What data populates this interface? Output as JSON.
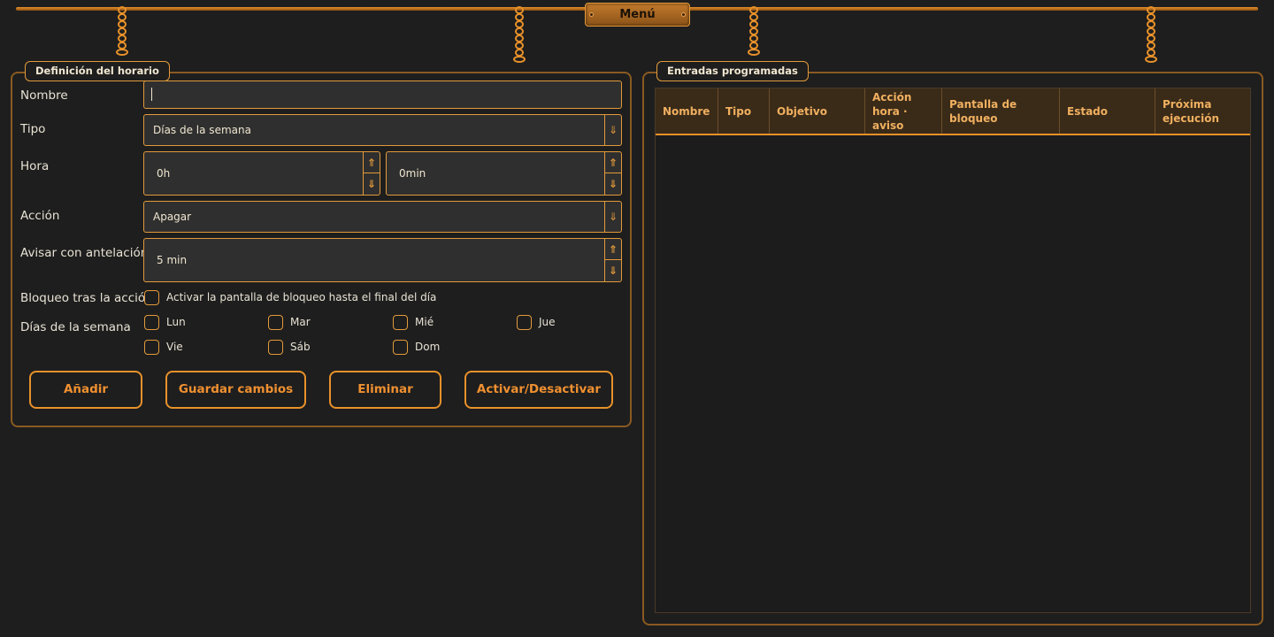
{
  "menu": {
    "label": "Menú"
  },
  "schedule": {
    "title": "Definición del horario",
    "name_label": "Nombre",
    "name_value": "",
    "type_label": "Tipo",
    "type_value": "Días de la semana",
    "time_label": "Hora",
    "hour_value": "0h",
    "minute_value": "0min",
    "action_label": "Acción",
    "action_value": "Apagar",
    "warn_label": "Avisar con antelación",
    "warn_value": "5 min",
    "lock_label": "Bloqueo tras la acción",
    "lock_checkbox_label": "Activar la pantalla de bloqueo hasta el final del día",
    "days_label": "Días de la semana",
    "days": [
      "Lun",
      "Mar",
      "Mié",
      "Jue",
      "Vie",
      "Sáb",
      "Dom"
    ],
    "buttons": {
      "add": "Añadir",
      "save": "Guardar cambios",
      "delete": "Eliminar",
      "toggle": "Activar/Desactivar"
    }
  },
  "entries": {
    "title": "Entradas programadas",
    "columns": [
      "Nombre",
      "Tipo",
      "Objetivo",
      "Acción\nhora · aviso",
      "Pantalla de bloqueo",
      "Estado",
      "Próxima\nejecución"
    ],
    "rows": []
  },
  "colors": {
    "background": "#1e1e1e",
    "accent": "#e8912a",
    "header_bg": "#3a2a18"
  }
}
